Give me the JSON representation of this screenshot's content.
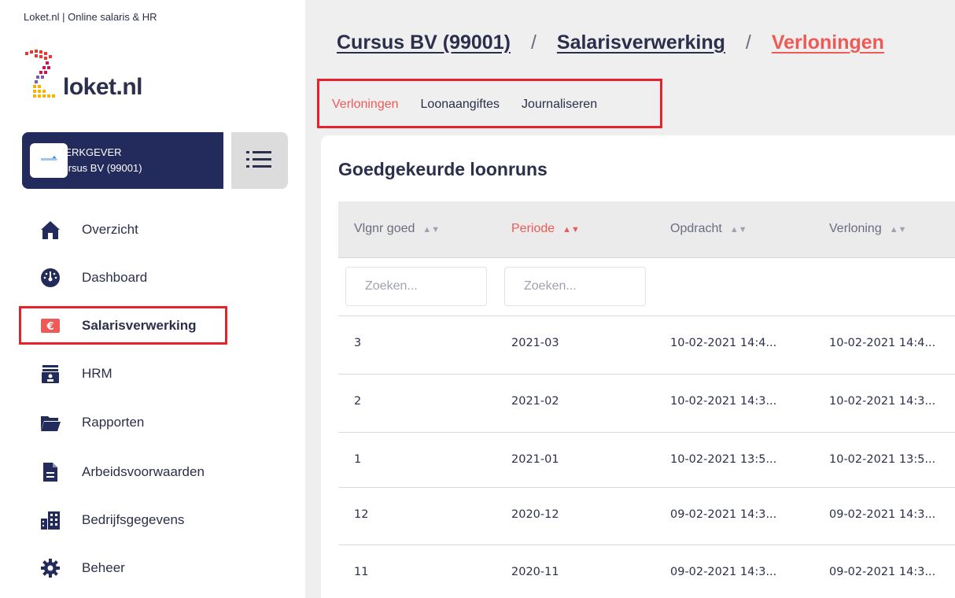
{
  "browser_title": "Loket.nl | Online salaris & HR",
  "logo": {
    "text": "loket.nl"
  },
  "employer": {
    "role": "WERKGEVER",
    "name": "Cursus BV (99001)"
  },
  "sidebar": {
    "items": [
      {
        "label": "Overzicht",
        "icon": "home-icon"
      },
      {
        "label": "Dashboard",
        "icon": "dashboard-icon"
      },
      {
        "label": "Salarisverwerking",
        "icon": "euro-icon",
        "active": true
      },
      {
        "label": "HRM",
        "icon": "id-card-icon"
      },
      {
        "label": "Rapporten",
        "icon": "folder-icon"
      },
      {
        "label": "Arbeidsvoorwaarden",
        "icon": "document-icon"
      },
      {
        "label": "Bedrijfsgegevens",
        "icon": "building-icon"
      },
      {
        "label": "Beheer",
        "icon": "gear-icon"
      }
    ]
  },
  "breadcrumb": {
    "items": [
      "Cursus BV (99001)",
      "Salarisverwerking",
      "Verloningen"
    ],
    "separator": "/"
  },
  "tabs": [
    "Verloningen",
    "Loonaangiftes",
    "Journaliseren"
  ],
  "table": {
    "title": "Goedgekeurde loonruns",
    "columns": [
      "Vlgnr goed",
      "Periode",
      "Opdracht",
      "Verloning"
    ],
    "search_placeholder": "Zoeken...",
    "rows": [
      {
        "vlgnr": "3",
        "periode": "2021-03",
        "opdracht": "10-02-2021 14:4...",
        "verloning": "10-02-2021 14:4..."
      },
      {
        "vlgnr": "2",
        "periode": "2021-02",
        "opdracht": "10-02-2021 14:3...",
        "verloning": "10-02-2021 14:3..."
      },
      {
        "vlgnr": "1",
        "periode": "2021-01",
        "opdracht": "10-02-2021 13:5...",
        "verloning": "10-02-2021 13:5..."
      },
      {
        "vlgnr": "12",
        "periode": "2020-12",
        "opdracht": "09-02-2021 14:3...",
        "verloning": "09-02-2021 14:3..."
      },
      {
        "vlgnr": "11",
        "periode": "2020-11",
        "opdracht": "09-02-2021 14:3...",
        "verloning": "09-02-2021 14:3..."
      }
    ]
  },
  "colors": {
    "navy": "#232a5c",
    "accent": "#ee5b57",
    "highlight": "#e8222a"
  }
}
